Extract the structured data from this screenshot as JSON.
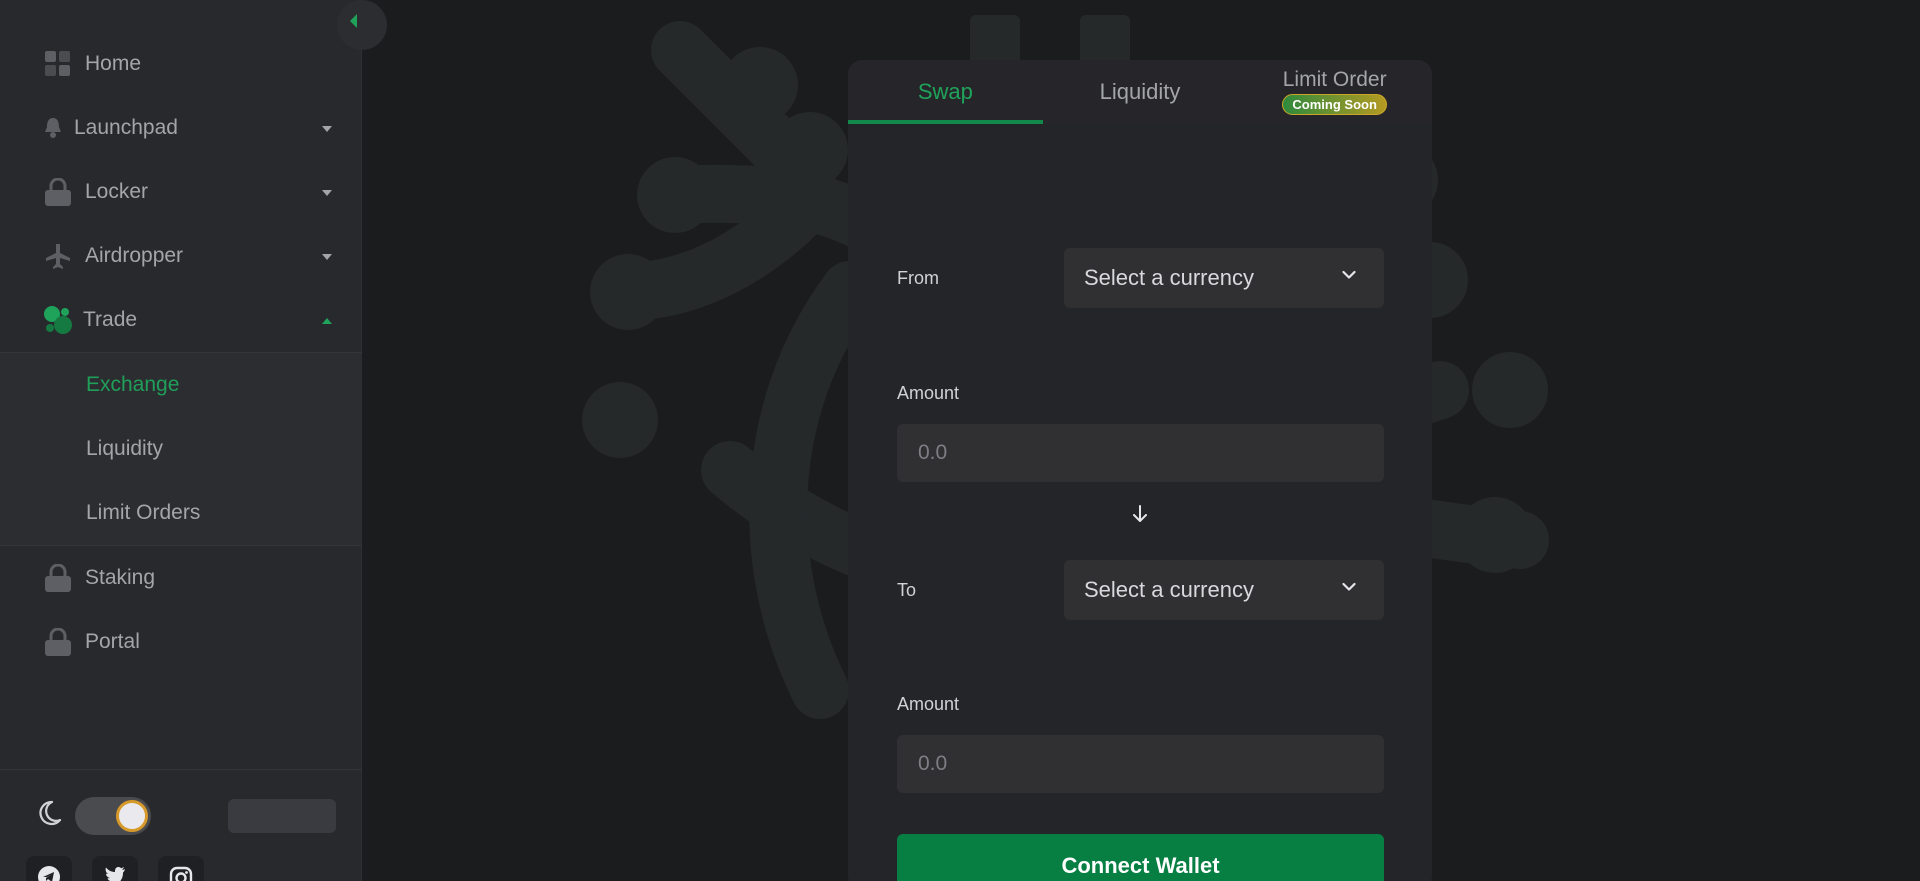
{
  "colors": {
    "accent": "#1fa35a",
    "button": "#077f43",
    "sidebar_bg": "#28292d",
    "page_bg": "#1b1c1e"
  },
  "sidebar": {
    "items": [
      {
        "label": "Home",
        "icon": "grid-icon"
      },
      {
        "label": "Launchpad",
        "icon": "bell-icon"
      },
      {
        "label": "Locker",
        "icon": "lock-icon"
      },
      {
        "label": "Airdropper",
        "icon": "airplane-icon"
      },
      {
        "label": "Trade",
        "icon": "trade-icon"
      }
    ],
    "trade_sub": [
      {
        "label": "Exchange",
        "active": true
      },
      {
        "label": "Liquidity"
      },
      {
        "label": "Limit Orders"
      }
    ],
    "more": [
      {
        "label": "Staking",
        "icon": "lock-icon"
      },
      {
        "label": "Portal",
        "icon": "lock-icon"
      }
    ],
    "theme": {
      "mode": "dark",
      "toggle_on": true
    },
    "socials": [
      "telegram-icon",
      "twitter-icon",
      "instagram-icon"
    ]
  },
  "tabs": [
    {
      "label": "Swap",
      "active": true
    },
    {
      "label": "Liquidity"
    },
    {
      "label": "Limit Order",
      "badge": "Coming Soon"
    }
  ],
  "swap": {
    "from_label": "From",
    "to_label": "To",
    "select_placeholder": "Select a currency",
    "amount_label": "Amount",
    "amount_placeholder": "0.0",
    "connect_label": "Connect Wallet"
  }
}
